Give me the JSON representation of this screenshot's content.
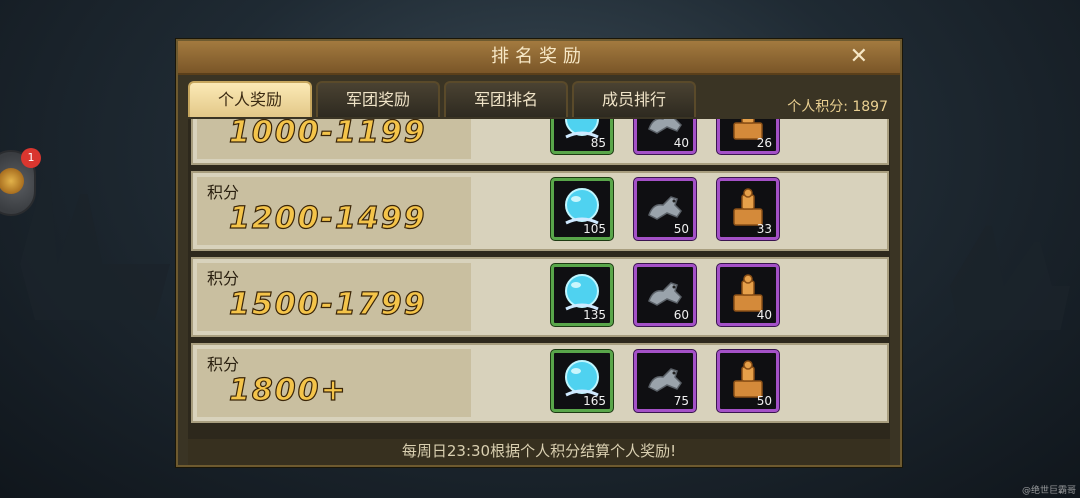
{
  "dialog": {
    "title": "排名奖励",
    "close_icon": "✕"
  },
  "side_button": {
    "icon": "event-icon",
    "badge": "1"
  },
  "tabs": [
    {
      "label": "个人奖励",
      "active": true
    },
    {
      "label": "军团奖励",
      "active": false
    },
    {
      "label": "军团排名",
      "active": false
    },
    {
      "label": "成员排行",
      "active": false
    }
  ],
  "personal_score": "个人积分: 1897",
  "rows": [
    {
      "label": "",
      "range": "1000-1199",
      "items": [
        {
          "name": "orb",
          "count": "85",
          "rarity": "green"
        },
        {
          "name": "horse",
          "count": "40",
          "rarity": "purple"
        },
        {
          "name": "seal",
          "count": "26",
          "rarity": "purple"
        }
      ]
    },
    {
      "label": "积分",
      "range": "1200-1499",
      "items": [
        {
          "name": "orb",
          "count": "105",
          "rarity": "green"
        },
        {
          "name": "horse",
          "count": "50",
          "rarity": "purple"
        },
        {
          "name": "seal",
          "count": "33",
          "rarity": "purple"
        }
      ]
    },
    {
      "label": "积分",
      "range": "1500-1799",
      "items": [
        {
          "name": "orb",
          "count": "135",
          "rarity": "green"
        },
        {
          "name": "horse",
          "count": "60",
          "rarity": "purple"
        },
        {
          "name": "seal",
          "count": "40",
          "rarity": "purple"
        }
      ]
    },
    {
      "label": "积分",
      "range": "1800+",
      "items": [
        {
          "name": "orb",
          "count": "165",
          "rarity": "green"
        },
        {
          "name": "horse",
          "count": "75",
          "rarity": "purple"
        },
        {
          "name": "seal",
          "count": "50",
          "rarity": "purple"
        }
      ]
    }
  ],
  "footer_note": "每周日23:30根据个人积分结算个人奖励!",
  "watermark": "@绝世巨霸哥"
}
